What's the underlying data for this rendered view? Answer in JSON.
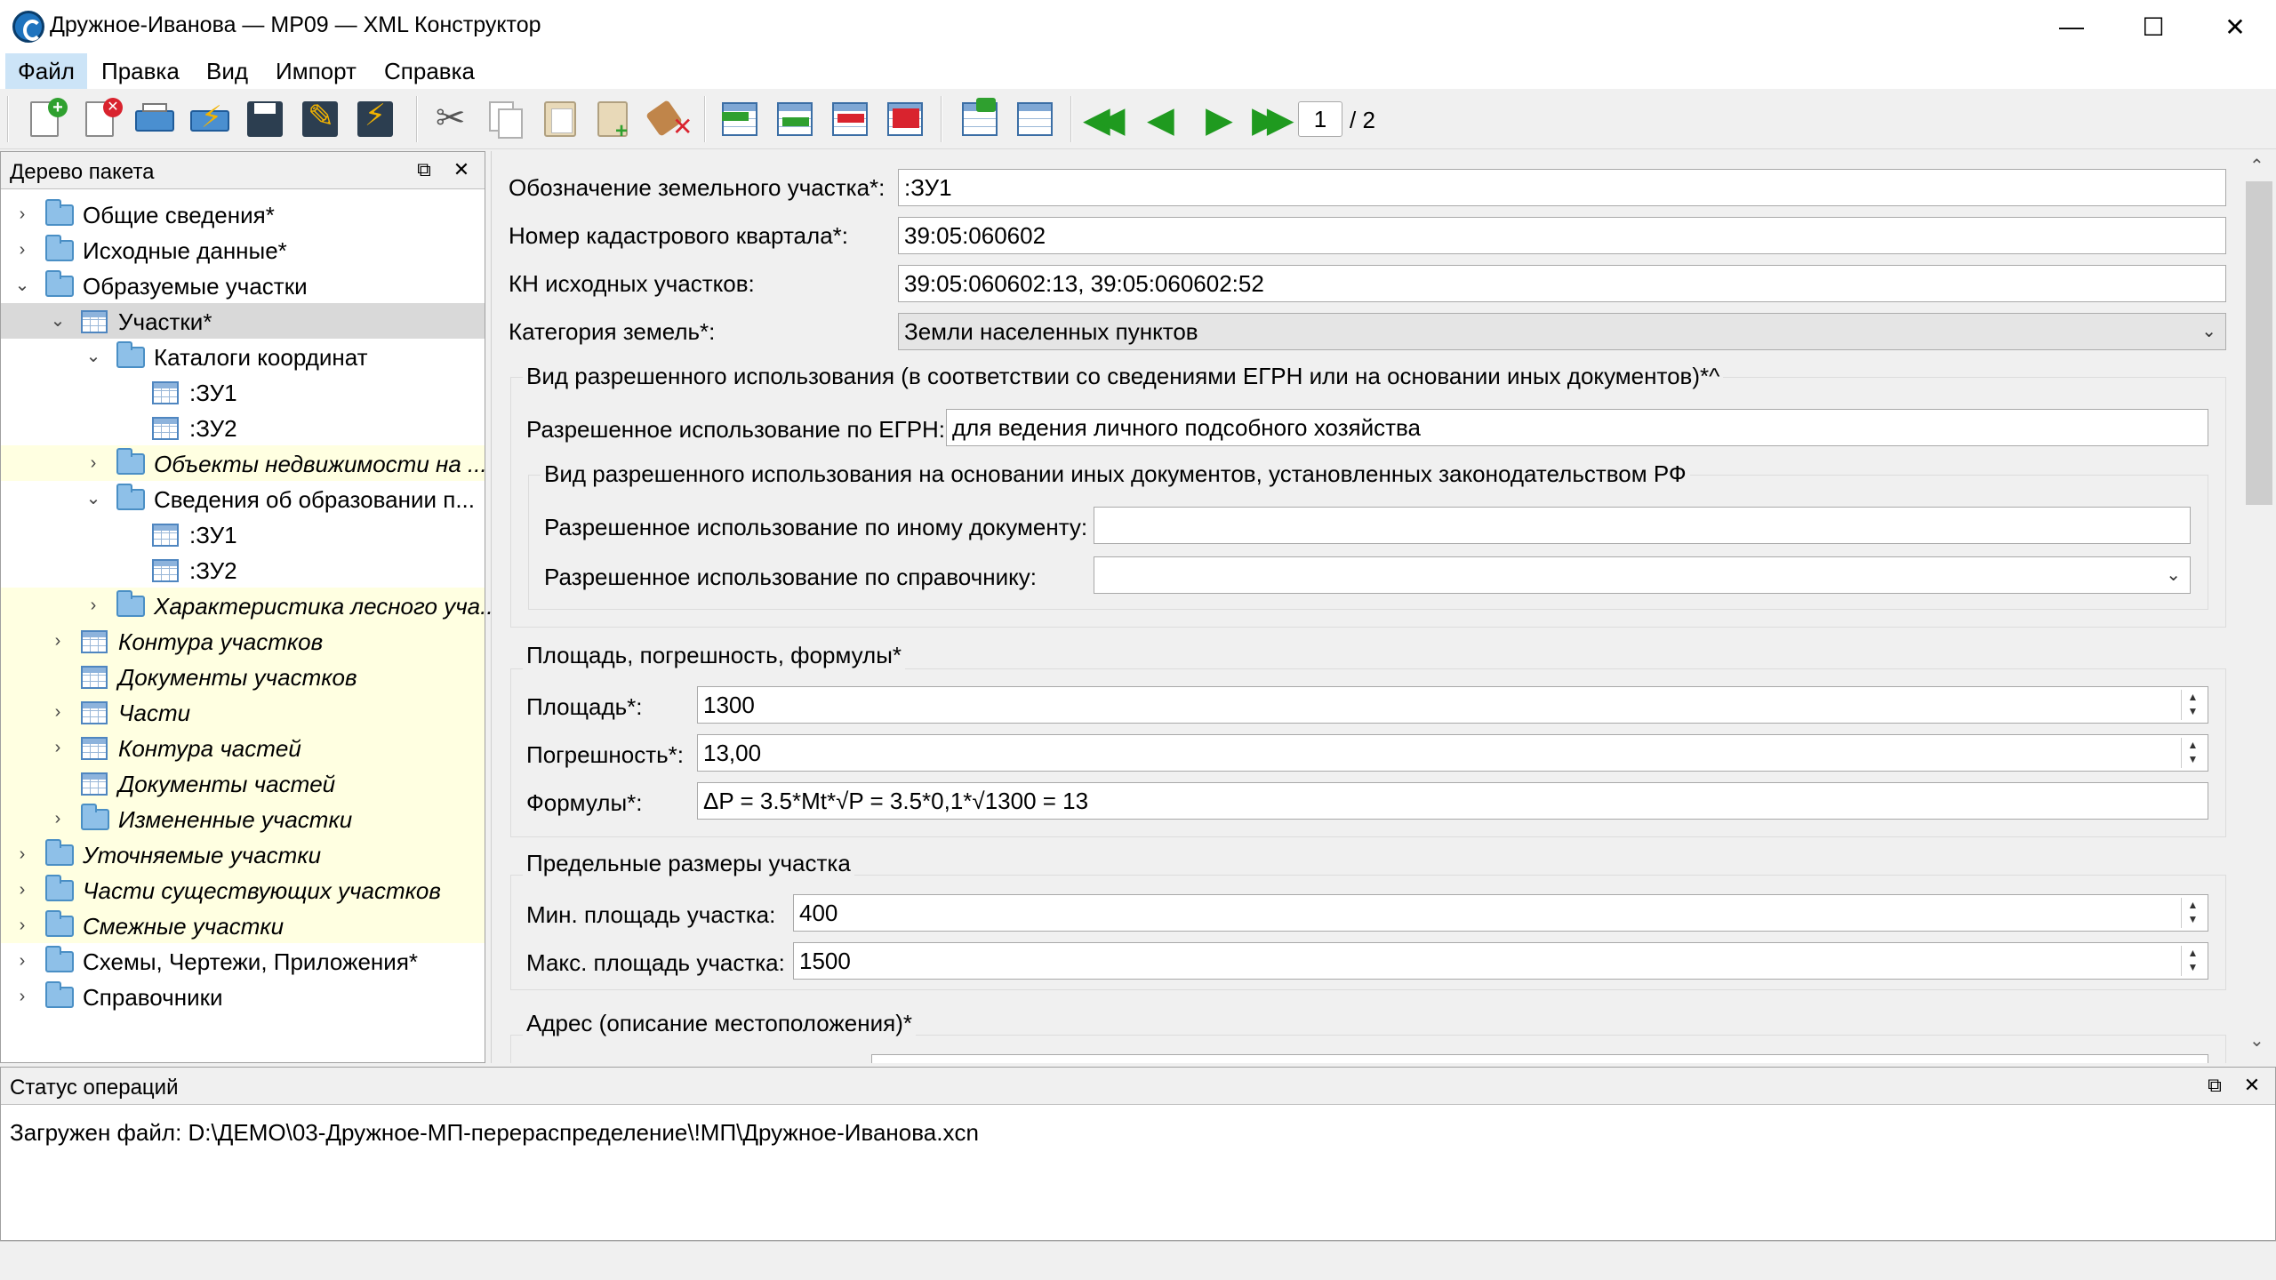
{
  "window": {
    "title": "Дружное-Иванова — МР09 — XML Конструктор",
    "minimize": "—",
    "maximize": "☐",
    "close": "✕"
  },
  "menu": [
    "Файл",
    "Правка",
    "Вид",
    "Импорт",
    "Справка"
  ],
  "toolbar": {
    "page_current": "1",
    "page_total": "/ 2"
  },
  "tree": {
    "title": "Дерево пакета",
    "nodes": [
      {
        "label": "Общие сведения*"
      },
      {
        "label": "Исходные данные*"
      },
      {
        "label": "Образуемые участки"
      },
      {
        "label": "Участки*"
      },
      {
        "label": "Каталоги координат"
      },
      {
        "label": ":ЗУ1"
      },
      {
        "label": ":ЗУ2"
      },
      {
        "label": "Объекты недвижимости на ..."
      },
      {
        "label": "Сведения об образовании п..."
      },
      {
        "label": ":ЗУ1"
      },
      {
        "label": ":ЗУ2"
      },
      {
        "label": "Характеристика лесного уча..."
      },
      {
        "label": "Контура участков"
      },
      {
        "label": "Документы участков"
      },
      {
        "label": "Части"
      },
      {
        "label": "Контура частей"
      },
      {
        "label": "Документы частей"
      },
      {
        "label": "Измененные участки"
      },
      {
        "label": "Уточняемые участки"
      },
      {
        "label": "Части существующих участков"
      },
      {
        "label": "Смежные участки"
      },
      {
        "label": "Схемы, Чертежи, Приложения*"
      },
      {
        "label": "Справочники"
      }
    ]
  },
  "form": {
    "designation_label": "Обозначение земельного участка*:",
    "designation_value": ":ЗУ1",
    "quarter_label": "Номер кадастрового квартала*:",
    "quarter_value": "39:05:060602",
    "source_label": "КН исходных участков:",
    "source_value": "39:05:060602:13, 39:05:060602:52",
    "category_label": "Категория земель*:",
    "category_value": "Земли населенных пунктов",
    "use_group_title": "Вид разрешенного использования (в соответствии со сведениями ЕГРН или на основании иных документов)*^",
    "egrn_label": "Разрешенное использование по ЕГРН:",
    "egrn_value": "для ведения личного подсобного хозяйства",
    "other_group_title": "Вид разрешенного использования на основании иных документов, установленных законодательством РФ",
    "other_doc_label": "Разрешенное использование по иному документу:",
    "other_doc_value": "",
    "ref_label": "Разрешенное использование по справочнику:",
    "ref_value": "",
    "area_group_title": "Площадь, погрешность, формулы*",
    "area_label": "Площадь*:",
    "area_value": "1300",
    "error_label": "Погрешность*:",
    "error_value": "13,00",
    "formula_label": "Формулы*:",
    "formula_value": "ΔP = 3.5*Mt*√P = 3.5*0,1*√1300 = 13",
    "limits_group_title": "Предельные размеры участка",
    "min_label": "Мин. площадь участка:",
    "min_value": "400",
    "max_label": "Макс. площадь участка:",
    "max_value": "1500",
    "address_group_title": "Адрес (описание местоположения)*"
  },
  "status": {
    "title": "Статус операций",
    "text": "Загружен файл: D:\\ДЕМО\\03-Дружное-МП-перераспределение\\!МП\\Дружное-Иванова.xcn"
  }
}
